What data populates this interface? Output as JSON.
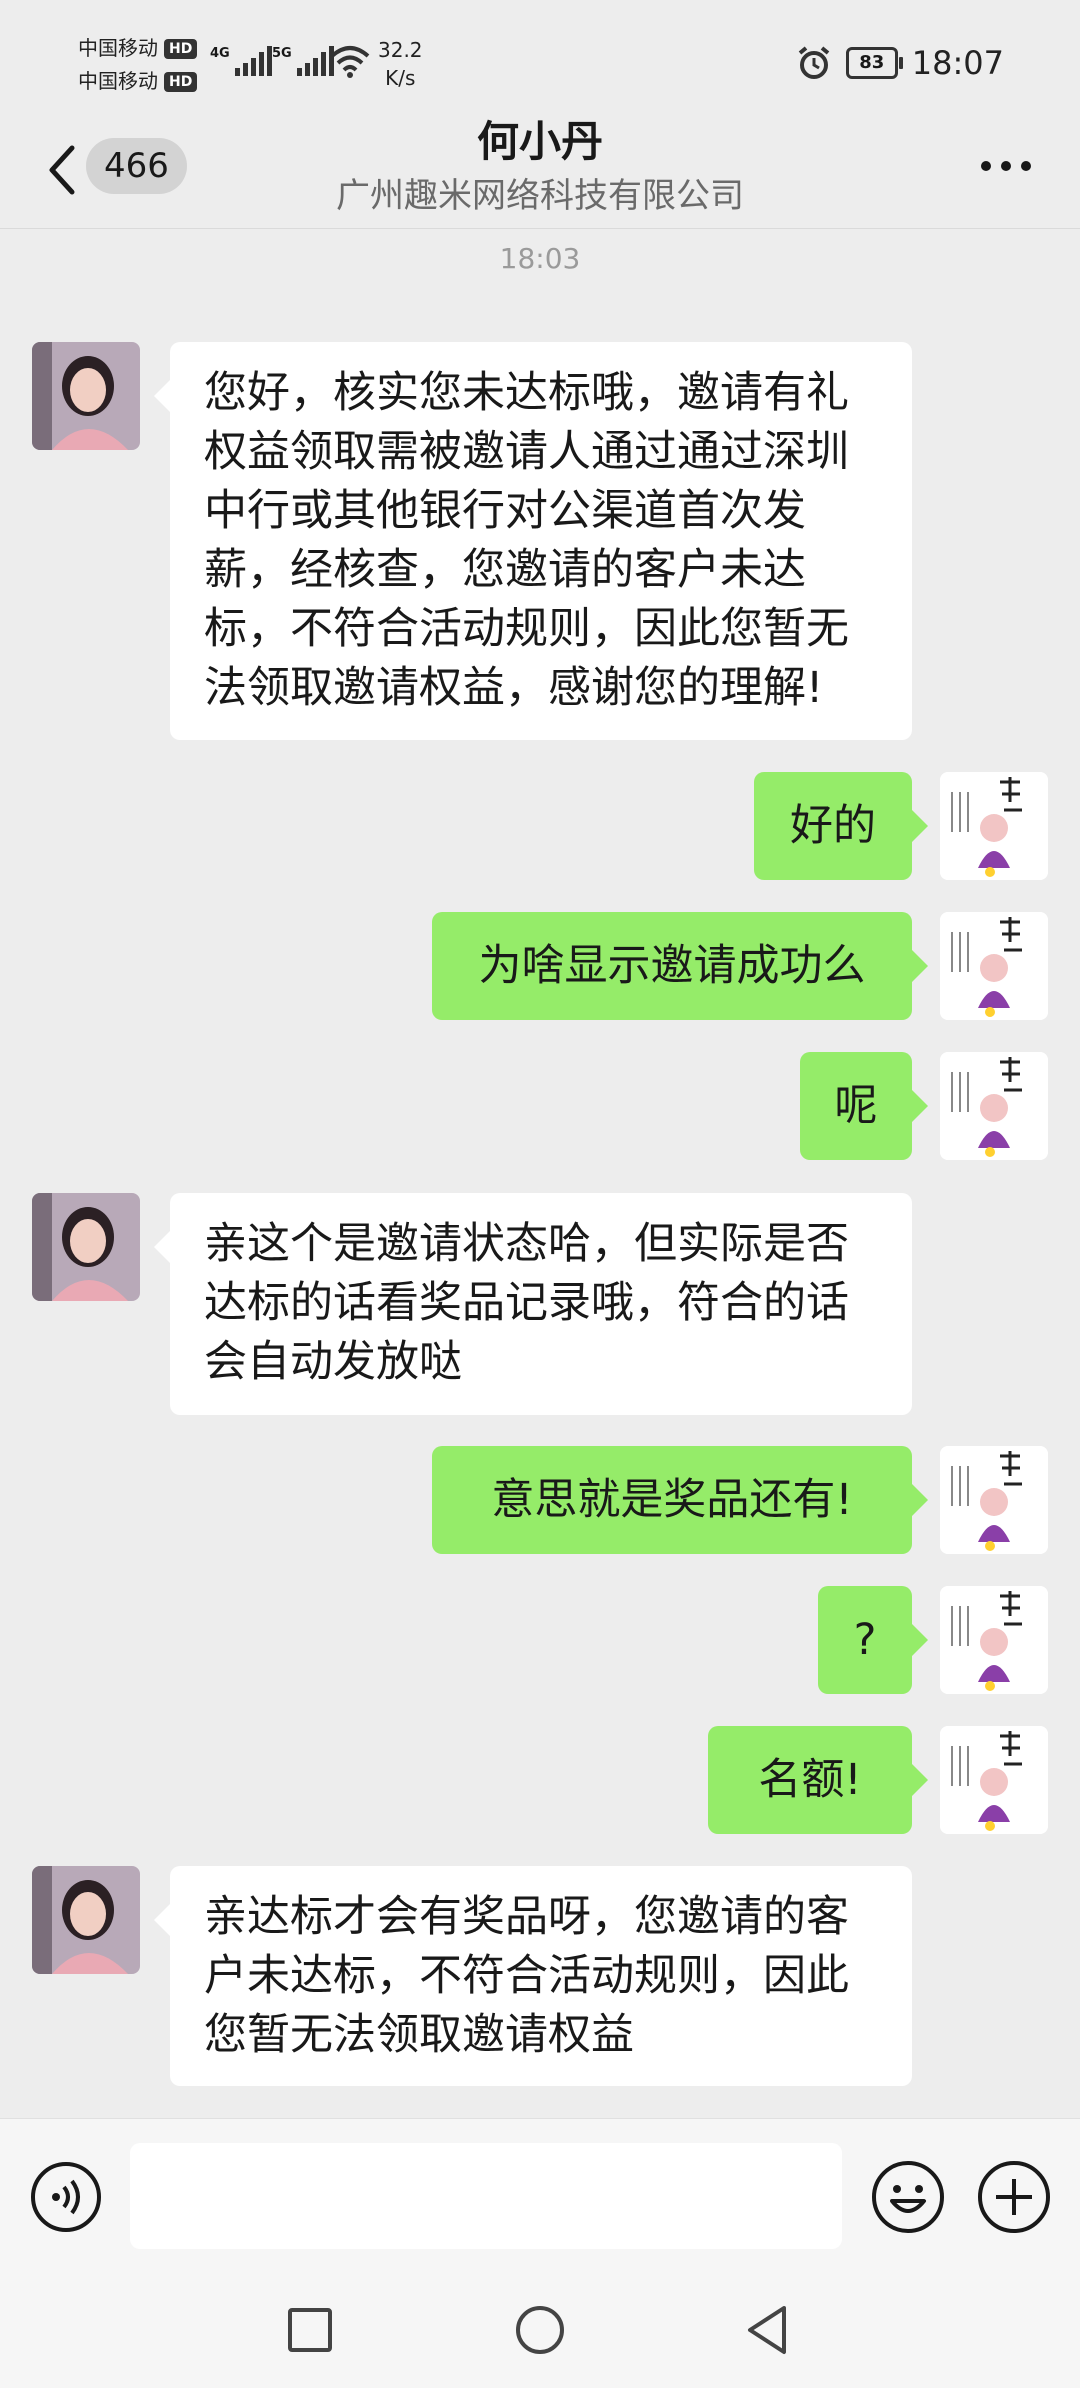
{
  "status": {
    "carrier1": "中国移动",
    "carrier2": "中国移动",
    "hd": "HD",
    "net1": "4G",
    "net2": "5G",
    "speed_value": "32.2",
    "speed_unit": "K/s",
    "battery": "83",
    "time": "18:07"
  },
  "header": {
    "unread_count": "466",
    "title": "何小丹",
    "subtitle": "广州趣米网络科技有限公司"
  },
  "chat": {
    "timestamp": "18:03",
    "messages": [
      {
        "side": "in",
        "text": "您好，核实您未达标哦，邀请有礼权益领取需被邀请人通过通过深圳中行或其他银行对公渠道首次发薪，经核查，您邀请的客户未达标，不符合活动规则，因此您暂无法领取邀请权益，感谢您的理解!"
      },
      {
        "side": "out",
        "text": "好的"
      },
      {
        "side": "out",
        "text": "为啥显示邀请成功么"
      },
      {
        "side": "out",
        "text": "呢"
      },
      {
        "side": "in",
        "text": "亲这个是邀请状态哈，但实际是否达标的话看奖品记录哦，符合的话会自动发放哒"
      },
      {
        "side": "out",
        "text": "意思就是奖品还有!"
      },
      {
        "side": "out",
        "text": "?"
      },
      {
        "side": "out",
        "text": "名额!"
      },
      {
        "side": "in",
        "text": "亲达标才会有奖品呀，您邀请的客户未达标，不符合活动规则，因此您暂无法领取邀请权益"
      }
    ]
  },
  "input": {
    "value": ""
  },
  "icons": {
    "back": "chevron-left-icon",
    "more": "more-icon",
    "voice": "voice-icon",
    "emoji": "emoji-icon",
    "plus": "plus-icon"
  },
  "colors": {
    "outgoing_bubble": "#95ec69",
    "incoming_bubble": "#ffffff",
    "background": "#ededed"
  }
}
